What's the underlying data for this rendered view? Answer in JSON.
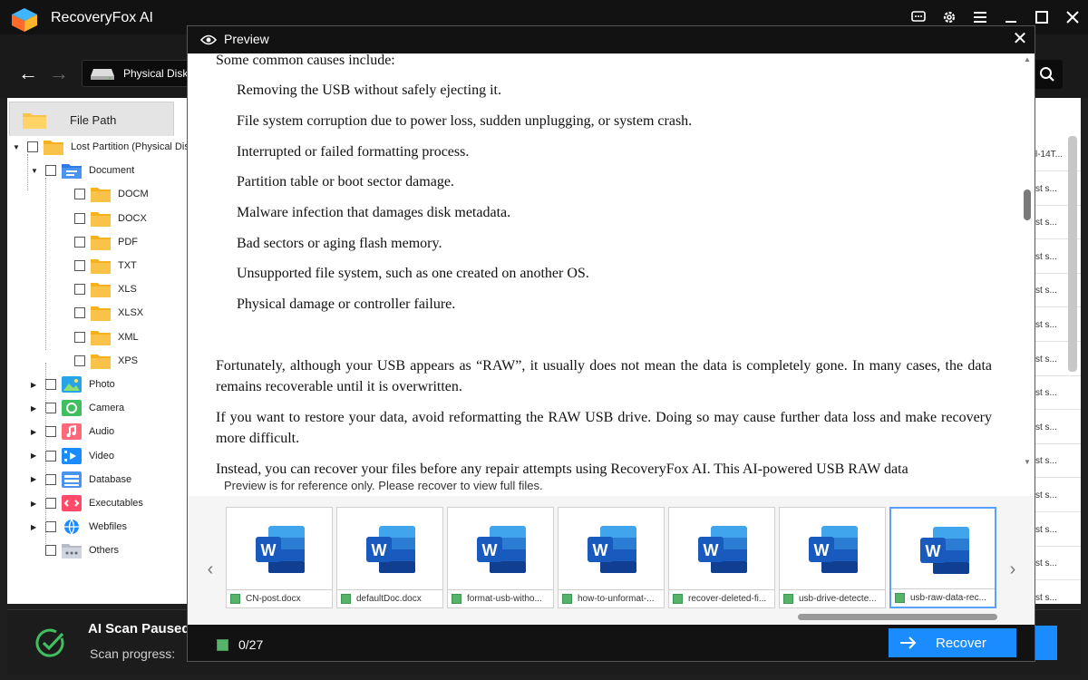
{
  "app": {
    "title": "RecoveryFox AI",
    "path_label": "Physical Disk",
    "file_path_tab": "File Path"
  },
  "tree": [
    {
      "label": "Lost Partition (Physical Disk",
      "icon": "folder-icon"
    },
    {
      "label": "Document",
      "icon": "document-icon"
    },
    {
      "label": "DOCM",
      "icon": "folder-icon"
    },
    {
      "label": "DOCX",
      "icon": "folder-icon"
    },
    {
      "label": "PDF",
      "icon": "folder-icon"
    },
    {
      "label": "TXT",
      "icon": "folder-icon"
    },
    {
      "label": "XLS",
      "icon": "folder-icon"
    },
    {
      "label": "XLSX",
      "icon": "folder-icon"
    },
    {
      "label": "XML",
      "icon": "folder-icon"
    },
    {
      "label": "XPS",
      "icon": "folder-icon"
    },
    {
      "label": "Photo",
      "icon": "photo-icon"
    },
    {
      "label": "Camera",
      "icon": "camera-icon"
    },
    {
      "label": "Audio",
      "icon": "audio-icon"
    },
    {
      "label": "Video",
      "icon": "video-icon"
    },
    {
      "label": "Database",
      "icon": "database-icon"
    },
    {
      "label": "Executables",
      "icon": "executable-icon"
    },
    {
      "label": "Webfiles",
      "icon": "web-icon"
    },
    {
      "label": "Others",
      "icon": "others-icon"
    }
  ],
  "file_list_snippets": [
    "l-14T...",
    "st s...",
    "st s...",
    "st s...",
    "st s...",
    "st s...",
    "st s...",
    "st s...",
    "st s...",
    "st s...",
    "st s...",
    "st s...",
    "st s...",
    "st s..."
  ],
  "status": {
    "title": "AI Scan Paused",
    "progress_label": "Scan progress:"
  },
  "preview": {
    "title": "Preview",
    "intro": "Some common causes include:",
    "causes": [
      "Removing the USB without safely ejecting it.",
      "File system corruption due to power loss, sudden unplugging, or system crash.",
      "Interrupted or failed formatting process.",
      "Partition table or boot sector damage.",
      "Malware infection that damages disk metadata.",
      "Bad sectors or aging flash memory.",
      "Unsupported file system, such as one created on another OS.",
      "Physical damage or controller failure."
    ],
    "paragraphs": [
      "Fortunately, although your USB appears as “RAW”, it usually does not mean the data is completely gone. In many cases, the data remains recoverable until it is overwritten.",
      "If you want to restore your data, avoid reformatting the RAW USB drive. Doing so may cause further data loss and make recovery more difficult.",
      "Instead, you can recover your files before any repair attempts using RecoveryFox AI. This AI-powered USB RAW data"
    ],
    "note": "Preview is for reference only. Please recover to view full files.",
    "thumbnails": [
      "CN-post.docx",
      "defaultDoc.docx",
      "format-usb-witho...",
      "how-to-unformat-...",
      "recover-deleted-fi...",
      "usb-drive-detecte...",
      "usb-raw-data-rec..."
    ],
    "selected_count": "0/27",
    "recover_label": "Recover"
  },
  "colors": {
    "accent": "#1a8cff",
    "check_green": "#56b46a",
    "folder_yellow": "#f9c349",
    "word_blue": "#185abd"
  }
}
